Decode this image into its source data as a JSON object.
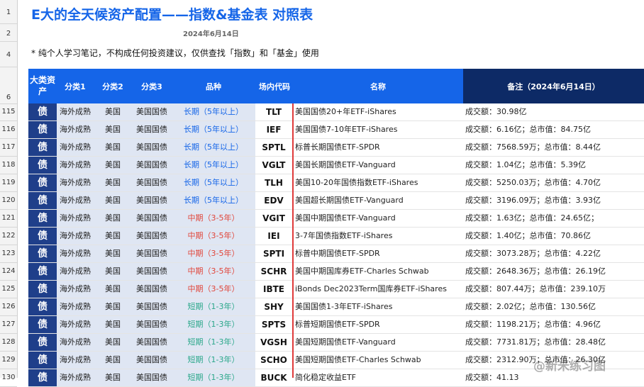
{
  "title": "E大的全天候资产配置——指数&基金表 对照表",
  "date": "2024年6月14日",
  "note": "* 纯个人学习笔记，不构成任何投资建议，仅供查找「指数」和「基金」使用",
  "row_numbers_top": [
    "1",
    "2",
    "4",
    "6"
  ],
  "headers": {
    "asset_class": "大类资产",
    "cat1": "分类1",
    "cat2": "分类2",
    "cat3": "分类3",
    "variety": "品种",
    "code": "场内代码",
    "name": "名称",
    "remark": "备注（2024年6月14日）"
  },
  "rows": [
    {
      "rn": "115",
      "asset": "债",
      "c1": "海外成熟",
      "c2": "美国",
      "c3": "美国国债",
      "variety": "长期（5年以上）",
      "vtype": "long",
      "code": "TLT",
      "name": "美国国债20+年ETF-iShares",
      "remark": "成交额：30.98亿"
    },
    {
      "rn": "116",
      "asset": "债",
      "c1": "海外成熟",
      "c2": "美国",
      "c3": "美国国债",
      "variety": "长期（5年以上）",
      "vtype": "long",
      "code": "IEF",
      "name": "美国国债7-10年ETF-iShares",
      "remark": "成交额：6.16亿；总市值：84.75亿"
    },
    {
      "rn": "117",
      "asset": "债",
      "c1": "海外成熟",
      "c2": "美国",
      "c3": "美国国债",
      "variety": "长期（5年以上）",
      "vtype": "long",
      "code": "SPTL",
      "name": "标普长期国债ETF-SPDR",
      "remark": "成交额：7568.59万；总市值：8.44亿"
    },
    {
      "rn": "118",
      "asset": "债",
      "c1": "海外成熟",
      "c2": "美国",
      "c3": "美国国债",
      "variety": "长期（5年以上）",
      "vtype": "long",
      "code": "VGLT",
      "name": "美国长期国债ETF-Vanguard",
      "remark": "成交额：1.04亿；总市值：5.39亿"
    },
    {
      "rn": "119",
      "asset": "债",
      "c1": "海外成熟",
      "c2": "美国",
      "c3": "美国国债",
      "variety": "长期（5年以上）",
      "vtype": "long",
      "code": "TLH",
      "name": "美国10-20年国债指数ETF-iShares",
      "remark": "成交额：5250.03万；总市值：4.70亿"
    },
    {
      "rn": "120",
      "asset": "债",
      "c1": "海外成熟",
      "c2": "美国",
      "c3": "美国国债",
      "variety": "长期（5年以上）",
      "vtype": "long",
      "code": "EDV",
      "name": "美国超长期国债ETF-Vanguard",
      "remark": "成交额：3196.09万；总市值：3.93亿"
    },
    {
      "rn": "121",
      "asset": "债",
      "c1": "海外成熟",
      "c2": "美国",
      "c3": "美国国债",
      "variety": "中期（3-5年）",
      "vtype": "mid",
      "code": "VGIT",
      "name": "美国中期国债ETF-Vanguard",
      "remark": "成交额：1.63亿；总市值：24.65亿；"
    },
    {
      "rn": "122",
      "asset": "债",
      "c1": "海外成熟",
      "c2": "美国",
      "c3": "美国国债",
      "variety": "中期（3-5年）",
      "vtype": "mid",
      "code": "IEI",
      "name": "3-7年国债指数ETF-iShares",
      "remark": "成交额：1.40亿；总市值：70.86亿"
    },
    {
      "rn": "123",
      "asset": "债",
      "c1": "海外成熟",
      "c2": "美国",
      "c3": "美国国债",
      "variety": "中期（3-5年）",
      "vtype": "mid",
      "code": "SPTI",
      "name": "标普中期国债ETF-SPDR",
      "remark": "成交额：3073.28万；总市值：4.22亿"
    },
    {
      "rn": "124",
      "asset": "债",
      "c1": "海外成熟",
      "c2": "美国",
      "c3": "美国国债",
      "variety": "中期（3-5年）",
      "vtype": "mid",
      "code": "SCHR",
      "name": "美国中期国库券ETF-Charles Schwab",
      "remark": "成交额：2648.36万；总市值：26.19亿"
    },
    {
      "rn": "125",
      "asset": "债",
      "c1": "海外成熟",
      "c2": "美国",
      "c3": "美国国债",
      "variety": "中期（3-5年）",
      "vtype": "mid",
      "code": "IBTE",
      "name": "iBonds Dec2023Term国库券ETF-iShares",
      "remark": "成交额：807.44万；总市值：239.10万"
    },
    {
      "rn": "126",
      "asset": "债",
      "c1": "海外成熟",
      "c2": "美国",
      "c3": "美国国债",
      "variety": "短期（1-3年）",
      "vtype": "short",
      "code": "SHY",
      "name": "美国国债1-3年ETF-iShares",
      "remark": "成交额：2.02亿；总市值：130.56亿"
    },
    {
      "rn": "127",
      "asset": "债",
      "c1": "海外成熟",
      "c2": "美国",
      "c3": "美国国债",
      "variety": "短期（1-3年）",
      "vtype": "short",
      "code": "SPTS",
      "name": "标普短期国债ETF-SPDR",
      "remark": "成交额：1198.21万；总市值：4.96亿"
    },
    {
      "rn": "128",
      "asset": "债",
      "c1": "海外成熟",
      "c2": "美国",
      "c3": "美国国债",
      "variety": "短期（1-3年）",
      "vtype": "short",
      "code": "VGSH",
      "name": "美国短期国债ETF-Vanguard",
      "remark": "成交额：7731.81万；总市值：28.48亿"
    },
    {
      "rn": "129",
      "asset": "债",
      "c1": "海外成熟",
      "c2": "美国",
      "c3": "美国国债",
      "variety": "短期（1-3年）",
      "vtype": "short",
      "code": "SCHO",
      "name": "美国短期国债ETF-Charles Schwab",
      "remark": "成交额：2312.90万；总市值：26.30亿"
    },
    {
      "rn": "130",
      "asset": "债",
      "c1": "海外成熟",
      "c2": "美国",
      "c3": "美国国债",
      "variety": "短期（1-3年）",
      "vtype": "short",
      "code": "BUCK",
      "name": "简化稳定收益ETF",
      "remark": "成交额：41.13"
    }
  ],
  "watermark": "@新米练习图",
  "colors": {
    "header_blue": "#1565e8",
    "header_dark": "#0d2a66",
    "long": "#1565e8",
    "mid": "#e0453a",
    "short": "#2aa78a"
  }
}
